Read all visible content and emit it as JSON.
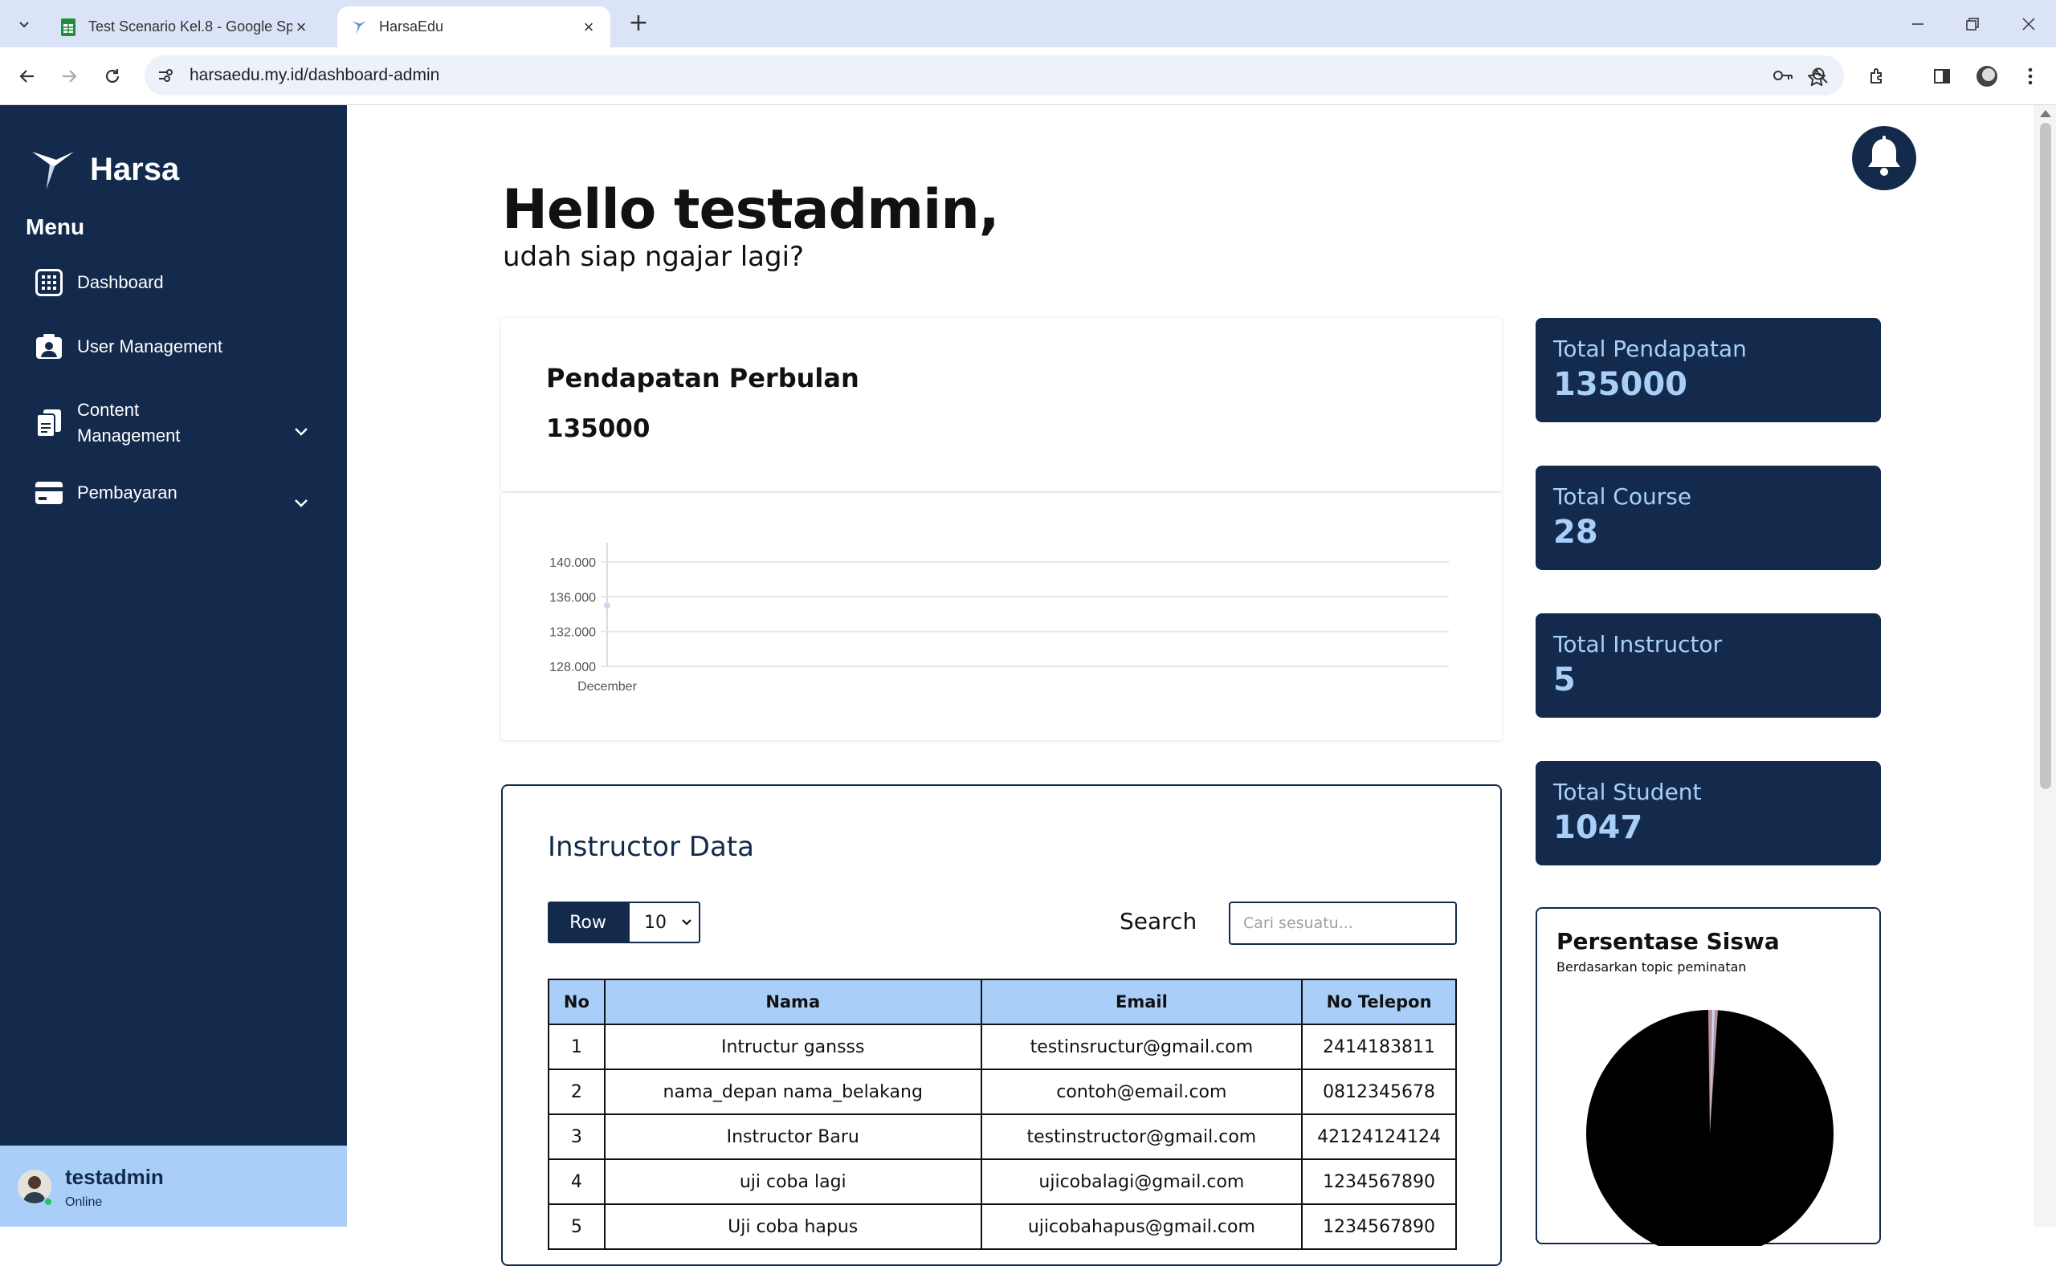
{
  "browser": {
    "tabs": [
      {
        "title": "Test Scenario Kel.8 - Google Sp",
        "active": false,
        "favicon": "google-sheets-icon"
      },
      {
        "title": "HarsaEdu",
        "active": true,
        "favicon": "harsa-bird-icon"
      }
    ],
    "url": "harsaedu.my.id/dashboard-admin"
  },
  "sidebar": {
    "brand": "Harsa",
    "menu_title": "Menu",
    "items": [
      {
        "label": "Dashboard",
        "icon": "grid-icon"
      },
      {
        "label": "User Management",
        "icon": "user-card-icon"
      },
      {
        "label": "Content\nManagement",
        "icon": "documents-icon",
        "expandable": true
      },
      {
        "label": "Pembayaran",
        "icon": "credit-card-icon",
        "expandable": true
      }
    ],
    "user": {
      "name": "testadmin",
      "status": "Online"
    }
  },
  "main": {
    "greeting": "Hello testadmin,",
    "subtitle": "udah siap ngajar lagi?",
    "revenue_card": {
      "title": "Pendapatan Perbulan",
      "value": "135000"
    },
    "stats": [
      {
        "label": "Total Pendapatan",
        "value": "135000"
      },
      {
        "label": "Total Course",
        "value": "28"
      },
      {
        "label": "Total Instructor",
        "value": "5"
      },
      {
        "label": "Total Student",
        "value": "1047"
      }
    ],
    "pie_card": {
      "title": "Persentase Siswa",
      "subtitle": "Berdasarkan topic peminatan"
    },
    "instructor_table": {
      "title": "Instructor Data",
      "row_button": "Row",
      "row_select_value": "10",
      "search_label": "Search",
      "search_placeholder": "Cari sesuatu...",
      "columns": [
        "No",
        "Nama",
        "Email",
        "No Telepon"
      ],
      "rows": [
        [
          "1",
          "Intructur gansss",
          "testinsructur@gmail.com",
          "2414183811"
        ],
        [
          "2",
          "nama_depan nama_belakang",
          "contoh@email.com",
          "0812345678"
        ],
        [
          "3",
          "Instructor Baru",
          "testinstructor@gmail.com",
          "42124124124"
        ],
        [
          "4",
          "uji coba lagi",
          "ujicobalagi@gmail.com",
          "1234567890"
        ],
        [
          "5",
          "Uji coba hapus",
          "ujicobahapus@gmail.com",
          "1234567890"
        ]
      ]
    }
  },
  "colors": {
    "navy": "#132a4c",
    "light_blue": "#a9cff9"
  },
  "chart_data": {
    "type": "line",
    "categories": [
      "December"
    ],
    "series": [
      {
        "values": [
          135000
        ]
      }
    ],
    "ylim": [
      128000,
      140000
    ],
    "yticks": [
      "128.000",
      "132.000",
      "136.000",
      "140.000"
    ],
    "grid": true,
    "title": "",
    "xlabel": "",
    "ylabel": ""
  }
}
